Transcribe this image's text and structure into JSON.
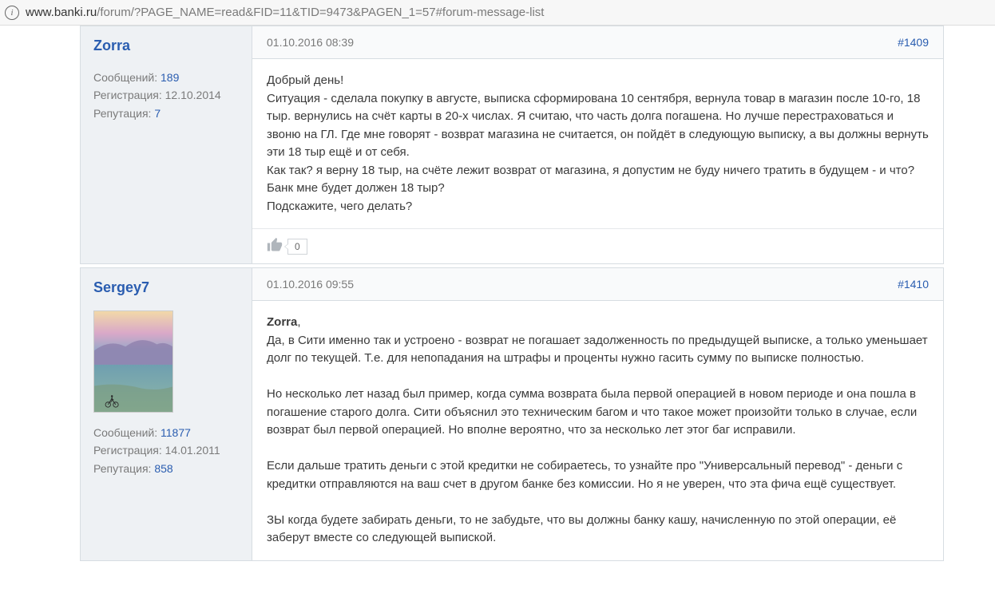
{
  "browser": {
    "url_prefix": "www.banki.ru",
    "url_path": "/forum/?PAGE_NAME=read&FID=11&TID=9473&PAGEN_1=57#forum-message-list"
  },
  "labels": {
    "messages": "Сообщений:",
    "registration": "Регистрация:",
    "reputation": "Репутация:"
  },
  "posts": [
    {
      "author": "Zorra",
      "has_avatar": false,
      "messages": "189",
      "registration": "12.10.2014",
      "reputation": "7",
      "date": "01.10.2016 08:39",
      "number": "#1409",
      "body_html": "Добрый день!<br>Ситуация - сделала покупку в августе, выписка сформирована 10 сентября, вернула товар в магазин после 10-го, 18 тыр. вернулись на счёт карты в 20-х числах. Я считаю, что часть долга погашена. Но лучше перестраховаться и звоню на ГЛ. Где мне говорят - возврат магазина не считается, он пойдёт в следующую выписку, а вы должны вернуть эти 18 тыр ещё и от себя.<br>Как так? я верну 18 тыр, на счёте лежит возврат от магазина, я допустим не буду ничего тратить в будущем - и что? Банк мне будет должен 18 тыр?<br>Подскажите, чего делать?",
      "likes": "0",
      "show_footer": true
    },
    {
      "author": "Sergey7",
      "has_avatar": true,
      "messages": "11877",
      "registration": "14.01.2011",
      "reputation": "858",
      "date": "01.10.2016 09:55",
      "number": "#1410",
      "body_html": "<strong>Zorra</strong>,<br>Да, в Сити именно так и устроено - возврат не погашает задолженность по предыдущей выписке, а только уменьшает долг по текущей. Т.е. для непопадания на штрафы и проценты нужно гасить сумму по выписке полностью.<br><br>Но несколько лет назад был пример, когда сумма возврата была первой операцией в новом периоде и она пошла в погашение старого долга. Сити объяснил это техническим багом и что такое может произойти только в случае, если возврат был первой операцией. Но вполне вероятно, что за несколько лет этог баг исправили.<br><br>Если дальше тратить деньги с этой кредитки не собираетесь, то узнайте про \"Универсальный перевод\" - деньги с кредитки отправляются на ваш счет в другом банке без комиссии. Но я не уверен, что эта фича ещё существует.<br><br>ЗЫ когда будете забирать деньги, то не забудьте, что вы должны банку кашу, начисленную по этой операции, её заберут вместе со следующей выпиской.",
      "likes": "0",
      "show_footer": false
    }
  ]
}
